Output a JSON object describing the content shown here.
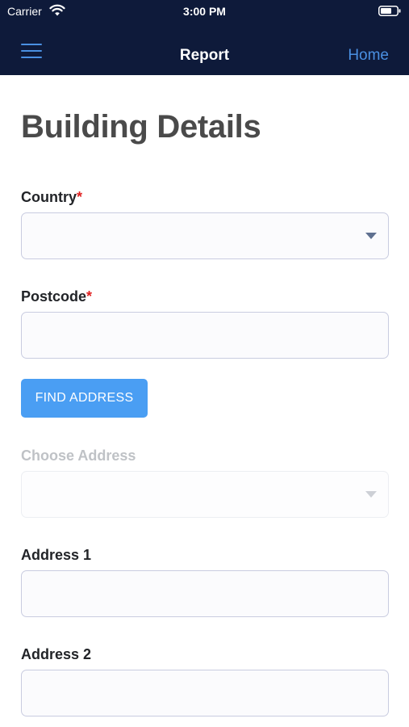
{
  "status_bar": {
    "carrier": "Carrier",
    "time": "3:00 PM"
  },
  "nav": {
    "title": "Report",
    "home": "Home"
  },
  "page_title": "Building Details",
  "fields": {
    "country": {
      "label": "Country",
      "required_mark": "*",
      "value": ""
    },
    "postcode": {
      "label": "Postcode",
      "required_mark": "*",
      "value": ""
    },
    "find_address": "FIND ADDRESS",
    "choose_address": {
      "label": "Choose Address",
      "value": ""
    },
    "address1": {
      "label": "Address 1",
      "value": ""
    },
    "address2": {
      "label": "Address 2",
      "value": ""
    }
  },
  "colors": {
    "nav_background": "#0e1a3a",
    "accent": "#4a90e2",
    "button": "#4a9ef3",
    "required": "#e02020"
  },
  "icons": [
    "wifi-icon",
    "battery-icon",
    "menu-icon",
    "dropdown-caret-icon"
  ]
}
